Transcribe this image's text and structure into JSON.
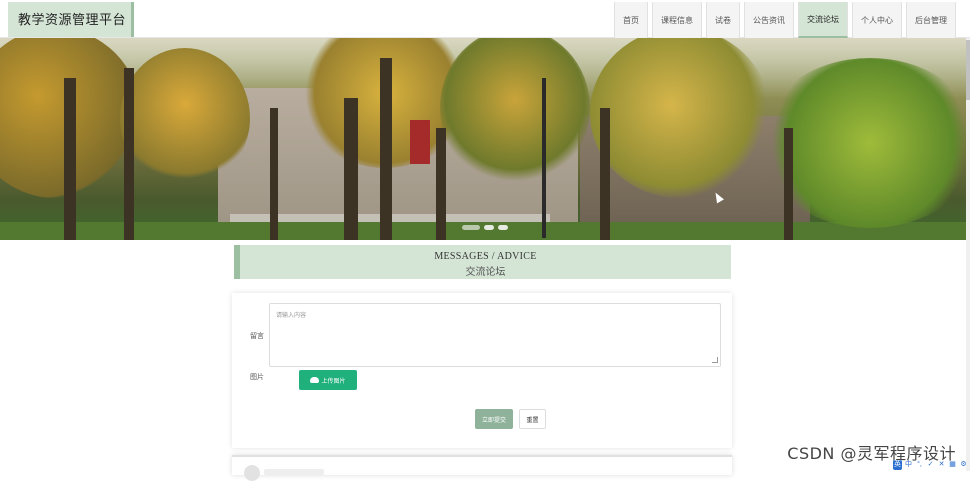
{
  "header": {
    "site_title": "教学资源管理平台",
    "nav": [
      {
        "label": "首页",
        "active": false
      },
      {
        "label": "课程信息",
        "active": false
      },
      {
        "label": "试卷",
        "active": false
      },
      {
        "label": "公告资讯",
        "active": false
      },
      {
        "label": "交流论坛",
        "active": true
      },
      {
        "label": "个人中心",
        "active": false
      },
      {
        "label": "后台管理",
        "active": false
      }
    ]
  },
  "banner": {
    "slide_count": 3,
    "active_slide": 1
  },
  "section": {
    "title_en": "MESSAGES / ADVICE",
    "title_cn": "交流论坛"
  },
  "form": {
    "message_label": "留言",
    "message_placeholder": "请输入内容",
    "image_label": "图片",
    "upload_label": "上传图片",
    "submit_label": "立即提交",
    "reset_label": "重置"
  },
  "watermark": "CSDN @灵军程序设计",
  "ime_bar": [
    "英",
    "中",
    "°,",
    "✓",
    "✕",
    "▦",
    "⚙"
  ],
  "colors": {
    "accent": "#d4e4d5",
    "accent_border": "#9dbfa1",
    "upload_button": "#20b07c",
    "submit_button": "#8fb29a"
  }
}
